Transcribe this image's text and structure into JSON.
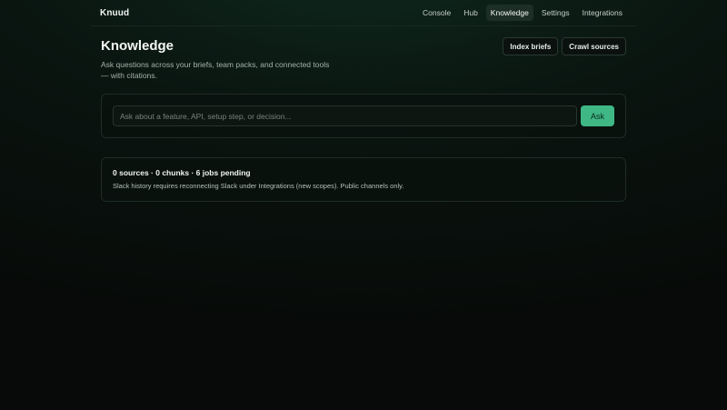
{
  "header": {
    "brand": "Knuud",
    "nav": [
      {
        "label": "Console",
        "active": false
      },
      {
        "label": "Hub",
        "active": false
      },
      {
        "label": "Knowledge",
        "active": true
      },
      {
        "label": "Settings",
        "active": false
      },
      {
        "label": "Integrations",
        "active": false
      }
    ]
  },
  "page": {
    "title": "Knowledge",
    "subtitle": "Ask questions across your briefs, team packs, and connected tools — with citations.",
    "actions": {
      "index_briefs": "Index briefs",
      "crawl_sources": "Crawl sources"
    }
  },
  "ask": {
    "placeholder": "Ask about a feature, API, setup step, or decision...",
    "value": "",
    "button_label": "Ask"
  },
  "status": {
    "summary": "0 sources · 0 chunks · 6 jobs pending",
    "note": "Slack history requires reconnecting Slack under Integrations (new scopes). Public channels only."
  },
  "colors": {
    "accent": "#3fb886",
    "background": "#070a08",
    "nav_active_bg": "#1d2e26"
  }
}
